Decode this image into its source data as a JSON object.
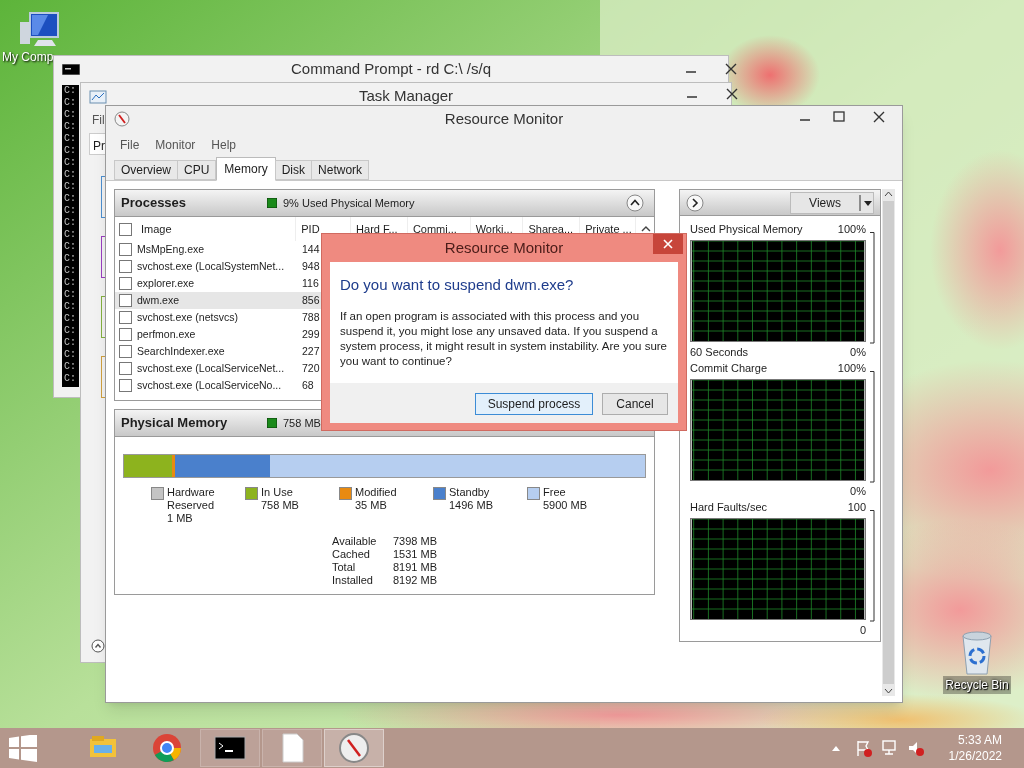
{
  "desktop": {
    "icons": [
      {
        "label": "My Comp"
      },
      {
        "label": "Recycle Bin"
      }
    ]
  },
  "command_prompt": {
    "title": "Command Prompt - rd  C:\\ /s/q",
    "lines": [
      "C:",
      "C:",
      "C:",
      "C:",
      "C:",
      "C:",
      "C:",
      "C:",
      "C:",
      "C:",
      "C:",
      "C:",
      "C:",
      "C:",
      "C:",
      "C:",
      "C:",
      "C:",
      "C:",
      "C:",
      "C:",
      "C:",
      "C:",
      "C:",
      "C:"
    ]
  },
  "task_manager": {
    "title": "Task Manager",
    "menu": [
      "Fil"
    ],
    "tab": "Pr"
  },
  "resource_monitor": {
    "title": "Resource Monitor",
    "menu": [
      "File",
      "Monitor",
      "Help"
    ],
    "tabs": [
      {
        "label": "Overview",
        "selected": false
      },
      {
        "label": "CPU",
        "selected": false
      },
      {
        "label": "Memory",
        "selected": true
      },
      {
        "label": "Disk",
        "selected": false
      },
      {
        "label": "Network",
        "selected": false
      }
    ],
    "processes": {
      "title": "Processes",
      "summary": "9% Used Physical Memory",
      "columns": [
        "Image",
        "PID",
        "Hard F...",
        "Commi...",
        "Worki...",
        "Sharea...",
        "Private ..."
      ],
      "rows": [
        {
          "image": "MsMpEng.exe",
          "pid": "144",
          "checked": false,
          "selected": false
        },
        {
          "image": "svchost.exe (LocalSystemNet...",
          "pid": "948",
          "checked": false,
          "selected": false
        },
        {
          "image": "explorer.exe",
          "pid": "116",
          "checked": false,
          "selected": false
        },
        {
          "image": "dwm.exe",
          "pid": "856",
          "checked": false,
          "selected": true
        },
        {
          "image": "svchost.exe (netsvcs)",
          "pid": "788",
          "checked": false,
          "selected": false
        },
        {
          "image": "perfmon.exe",
          "pid": "299",
          "checked": false,
          "selected": false
        },
        {
          "image": "SearchIndexer.exe",
          "pid": "227",
          "checked": false,
          "selected": false
        },
        {
          "image": "svchost.exe (LocalServiceNet...",
          "pid": "720",
          "checked": false,
          "selected": false
        },
        {
          "image": "svchost.exe (LocalServiceNo...",
          "pid": "68",
          "checked": false,
          "selected": false
        }
      ],
      "all_checked": false
    },
    "physical_memory": {
      "title": "Physical Memory",
      "summary": "758 MB",
      "legend": [
        {
          "label": "Hardware Reserved",
          "value": "1 MB",
          "color": "#c4c4c4"
        },
        {
          "label": "In Use",
          "value": "758 MB",
          "color": "#8db31e"
        },
        {
          "label": "Modified",
          "value": "35 MB",
          "color": "#e88a10"
        },
        {
          "label": "Standby",
          "value": "1496 MB",
          "color": "#4a80cc"
        },
        {
          "label": "Free",
          "value": "5900 MB",
          "color": "#b6cef0"
        }
      ],
      "bar": [
        {
          "color": "#8db31e",
          "level": 0.093
        },
        {
          "color": "#e88a10",
          "level": 0.004
        },
        {
          "color": "#4a80cc",
          "level": 0.183
        },
        {
          "color": "#b6cef0",
          "level": 0.72
        }
      ],
      "stats": [
        {
          "label": "Available",
          "value": "7398 MB"
        },
        {
          "label": "Cached",
          "value": "1531 MB"
        },
        {
          "label": "Total",
          "value": "8191 MB"
        },
        {
          "label": "Installed",
          "value": "8192 MB"
        }
      ]
    },
    "views_button": "Views",
    "graphs": [
      {
        "title": "Used Physical Memory",
        "max": "100%",
        "footer": "60 Seconds",
        "min": "0%"
      },
      {
        "title": "Commit Charge",
        "max": "100%",
        "min": "0%"
      },
      {
        "title": "Hard Faults/sec",
        "max": "100",
        "min": "0"
      }
    ]
  },
  "dialog": {
    "title": "Resource Monitor",
    "heading": "Do you want to suspend dwm.exe?",
    "message": "If an open program is associated with this process and you suspend it, you might lose any unsaved data. If you suspend a system process, it might result in system instability. Are you sure you want to continue?",
    "buttons": [
      {
        "label": "Suspend process",
        "kind": "default"
      },
      {
        "label": "Cancel",
        "kind": "normal"
      }
    ]
  },
  "taskbar": {
    "apps": [
      {
        "kind": "explorer",
        "selected": false
      },
      {
        "kind": "chrome",
        "selected": false
      },
      {
        "kind": "cmd",
        "selected": false
      },
      {
        "kind": "notepad",
        "selected": false
      },
      {
        "kind": "resmon",
        "selected": true
      }
    ],
    "time": "5:33 AM",
    "date": "1/26/2022"
  }
}
